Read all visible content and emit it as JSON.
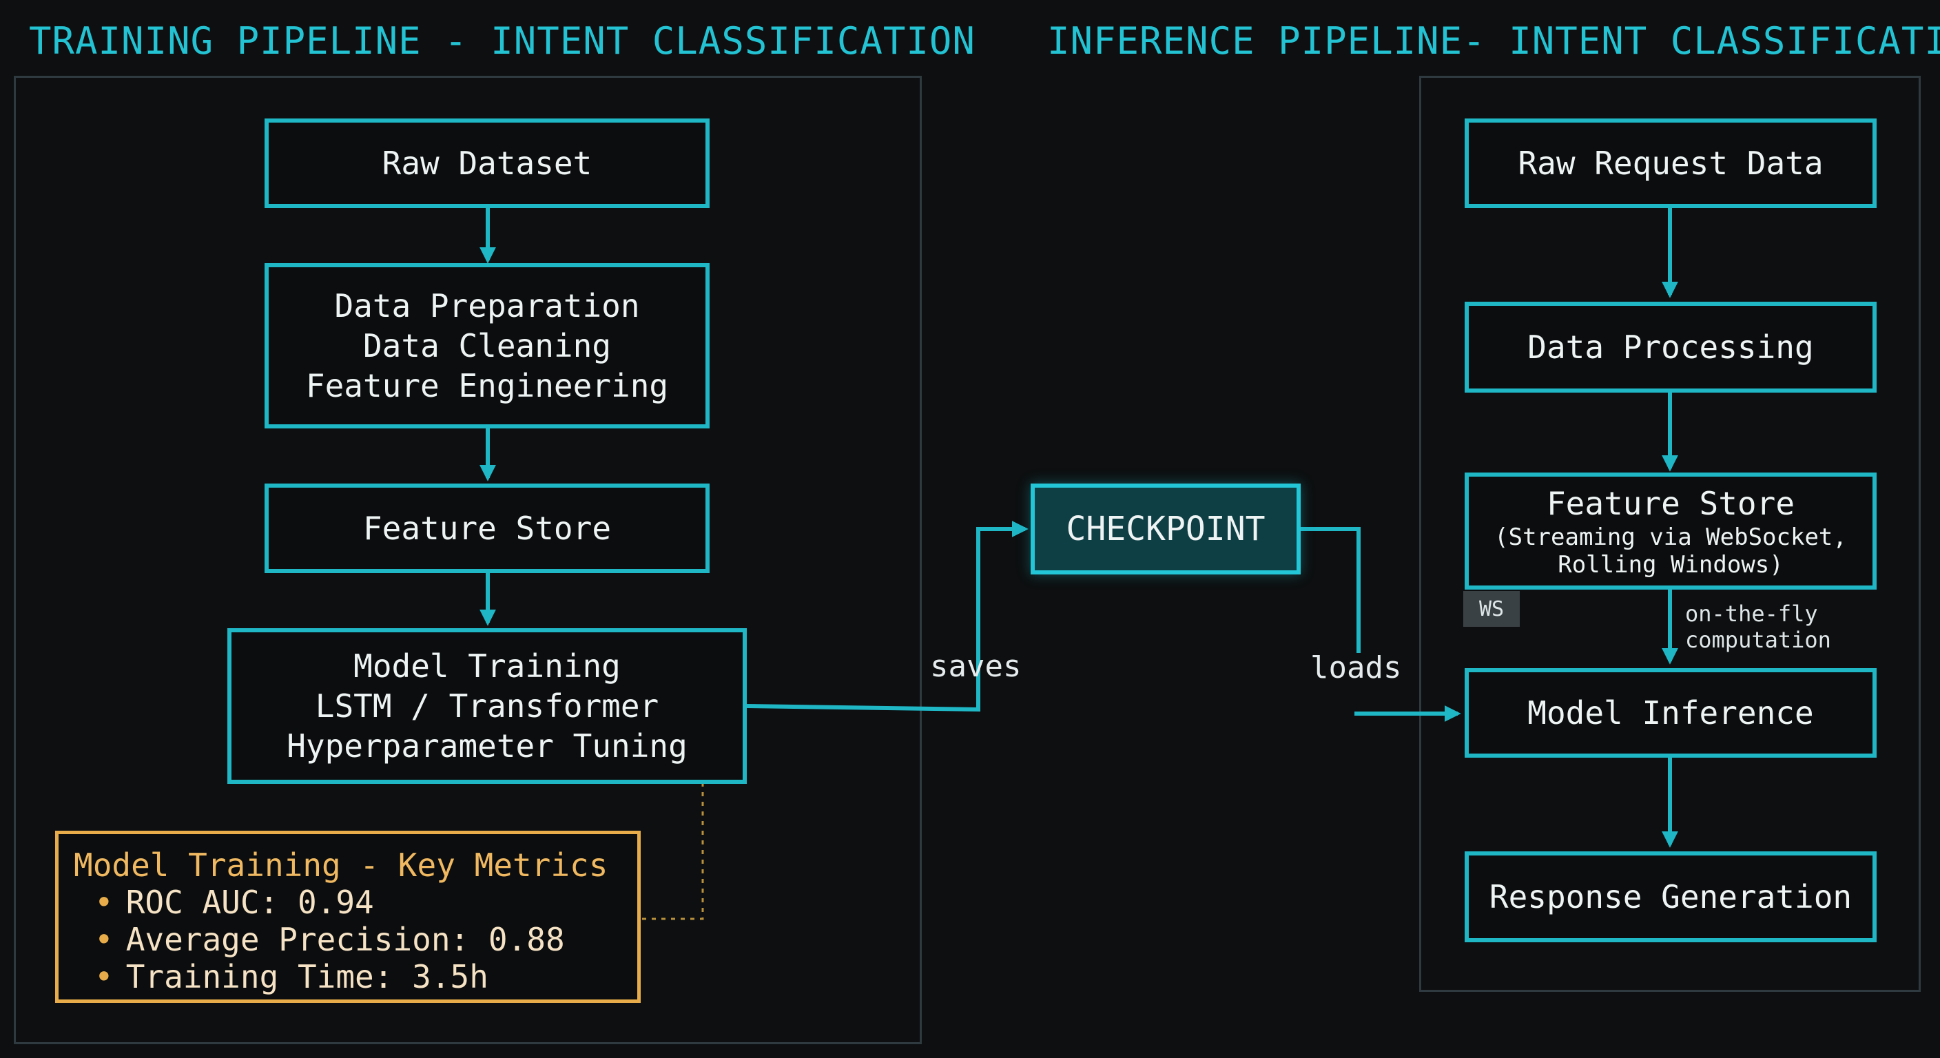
{
  "titles": {
    "training": "TRAINING PIPELINE - INTENT CLASSIFICATION",
    "inference": "INFERENCE PIPELINE- INTENT CLASSIFICATION"
  },
  "training": {
    "raw_dataset": "Raw Dataset",
    "data_prep": [
      "Data Preparation",
      "Data Cleaning",
      "Feature Engineering"
    ],
    "feature_store": "Feature Store",
    "model_training": [
      "Model Training",
      "LSTM / Transformer",
      "Hyperparameter Tuning"
    ],
    "metrics": {
      "title": "Model Training - Key Metrics",
      "items": [
        "ROC AUC: 0.94",
        "Average Precision: 0.88",
        "Training Time: 3.5h"
      ]
    }
  },
  "checkpoint": {
    "label": "CHECKPOINT",
    "saves": "saves",
    "loads": "loads"
  },
  "inference": {
    "raw_request": "Raw Request Data",
    "data_processing": "Data Processing",
    "feature_store": [
      "Feature Store",
      "(Streaming via WebSocket,",
      "Rolling Windows)"
    ],
    "ws_badge": "WS",
    "on_the_fly": [
      "on-the-fly",
      "computation"
    ],
    "model_inference": "Model Inference",
    "response": "Response Generation"
  },
  "colors": {
    "accent": "#1fb6c6",
    "metrics_border": "#e8ad4a",
    "background": "#0d0f10"
  }
}
